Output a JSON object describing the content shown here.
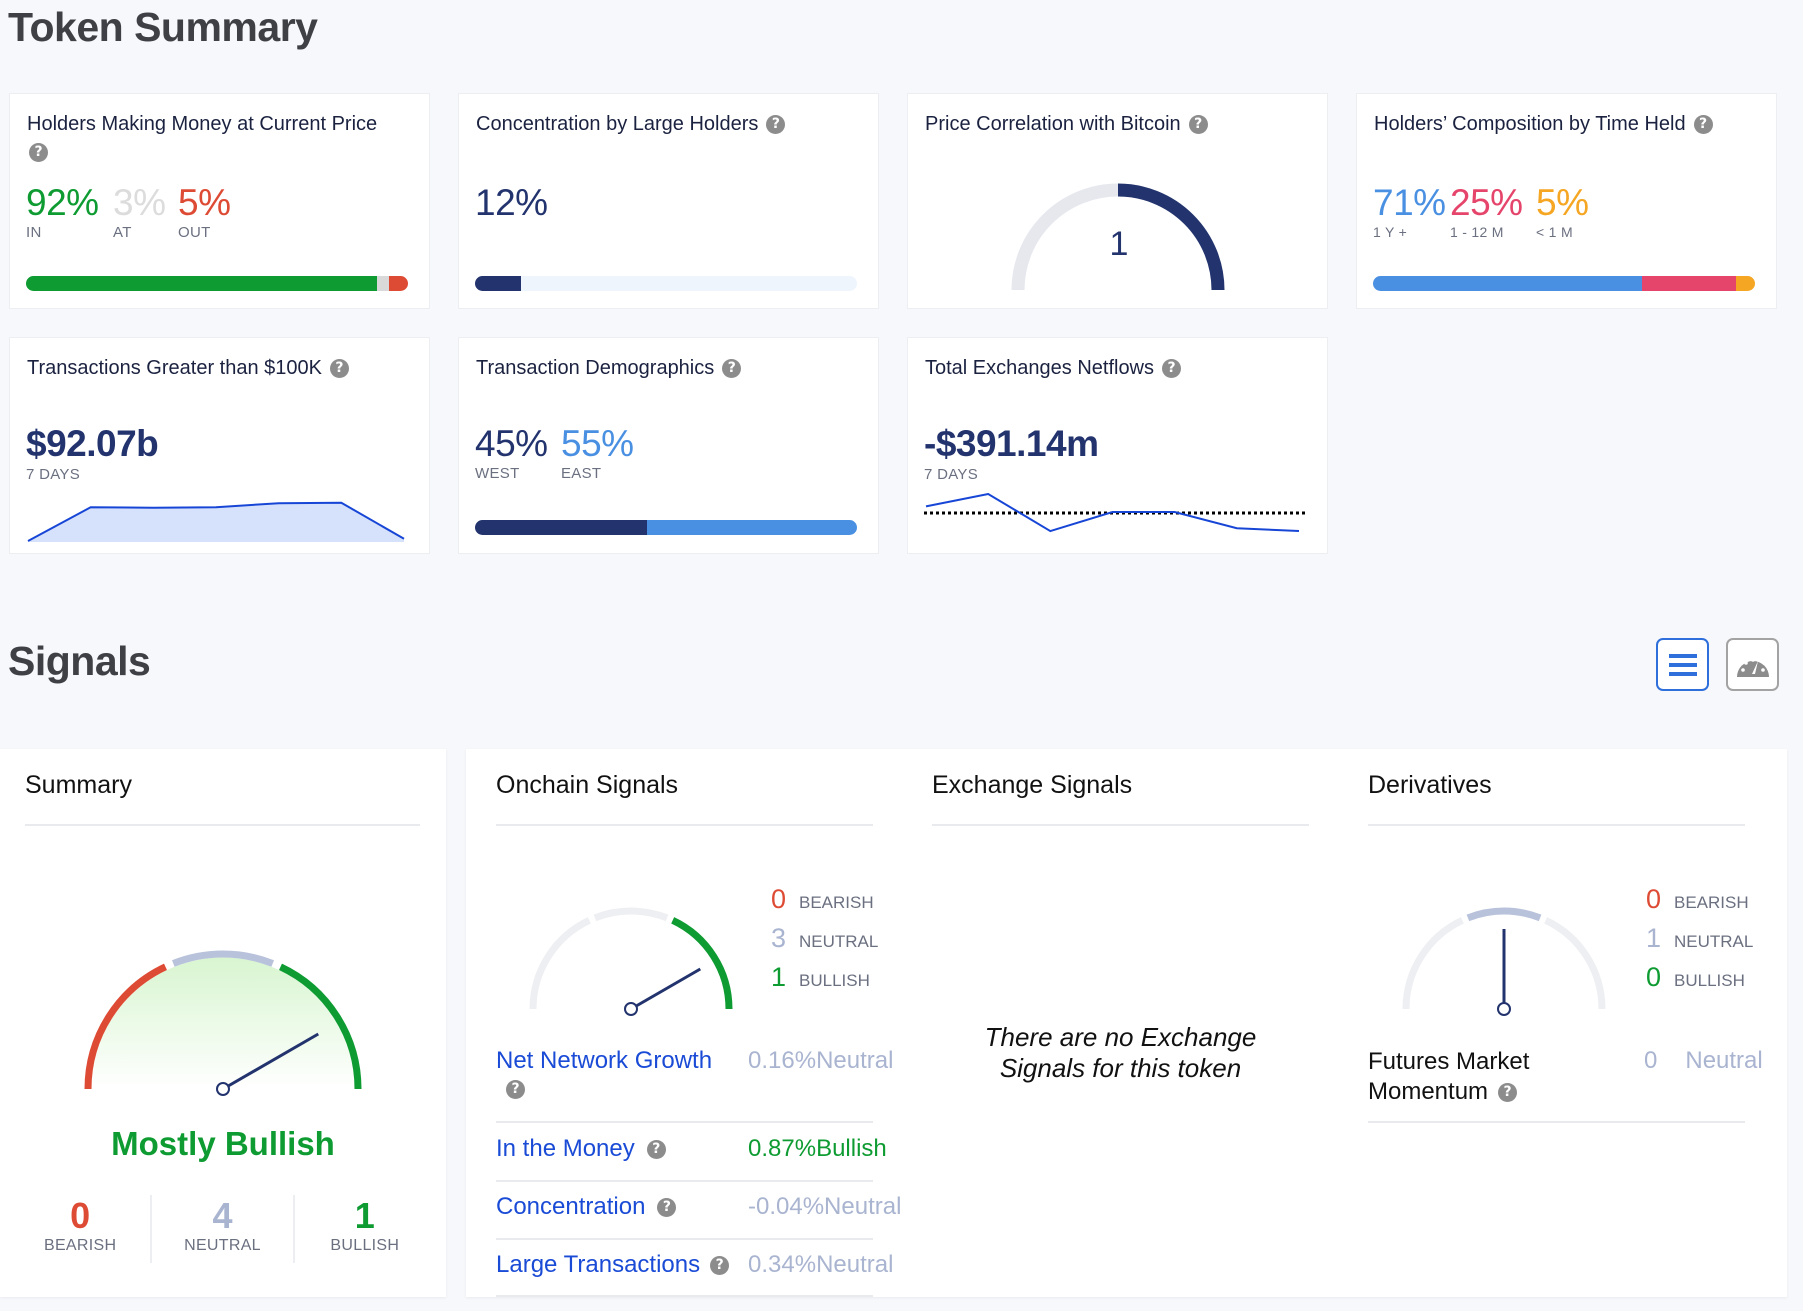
{
  "token_summary": {
    "title": "Token Summary",
    "cards": {
      "holders_money": {
        "title": "Holders Making Money at Current Price",
        "in": {
          "value": "92%",
          "label": "IN",
          "pct": 92,
          "color": "#0e9b32"
        },
        "at": {
          "value": "3%",
          "label": "AT",
          "pct": 3,
          "color": "#d9d9d9"
        },
        "out": {
          "value": "5%",
          "label": "OUT",
          "pct": 5,
          "color": "#de4b35"
        }
      },
      "concentration": {
        "title": "Concentration by Large Holders",
        "value": "12%",
        "pct": 12,
        "color": "#22336e",
        "track_color": "#eef5fd"
      },
      "correlation": {
        "title": "Price Correlation with Bitcoin",
        "value": "1",
        "correlation": 1
      },
      "time_held": {
        "title": "Holders’ Composition by Time Held",
        "segments": [
          {
            "value": "71%",
            "label": "1 Y +",
            "pct": 71,
            "color": "#4a90e2"
          },
          {
            "value": "25%",
            "label": "1 - 12 M",
            "pct": 25,
            "color": "#e6456b"
          },
          {
            "value": "5%",
            "label": "< 1 M",
            "pct": 5,
            "color": "#f5a623"
          }
        ]
      },
      "large_tx": {
        "title": "Transactions Greater than $100K",
        "value": "$92.07b",
        "period": "7 DAYS",
        "sparkline": [
          0,
          0.75,
          0.74,
          0.75,
          0.84,
          0.85,
          0.05
        ]
      },
      "demographics": {
        "title": "Transaction Demographics",
        "west": {
          "value": "45%",
          "label": "WEST",
          "pct": 45,
          "color": "#22336e"
        },
        "east": {
          "value": "55%",
          "label": "EAST",
          "pct": 55,
          "color": "#4a90e2"
        }
      },
      "netflows": {
        "title": "Total Exchanges Netflows",
        "value": "-$391.14m",
        "period": "7 DAYS",
        "sparkline": [
          0.35,
          1.0,
          -0.95,
          0.05,
          0.05,
          -0.8,
          -0.95
        ]
      }
    }
  },
  "signals": {
    "title": "Signals",
    "view_list_icon": "list-icon",
    "view_gauge_icon": "gauge-icon",
    "summary": {
      "heading": "Summary",
      "verdict": "Mostly Bullish",
      "verdict_color": "#0e9b32",
      "needle_angle_deg": 60,
      "counts": [
        {
          "num": "0",
          "label": "BEARISH",
          "color": "#de4b35"
        },
        {
          "num": "4",
          "label": "NEUTRAL",
          "color": "#a9b4d0"
        },
        {
          "num": "1",
          "label": "BULLISH",
          "color": "#0e9b32"
        }
      ]
    },
    "onchain": {
      "heading": "Onchain Signals",
      "needle_angle_deg": 60,
      "counts": [
        {
          "num": "0",
          "label": "BEARISH",
          "color": "#de4b35"
        },
        {
          "num": "3",
          "label": "NEUTRAL",
          "color": "#a9b4d0"
        },
        {
          "num": "1",
          "label": "BULLISH",
          "color": "#0e9b32"
        }
      ],
      "rows": [
        {
          "name": "Net Network Growth",
          "value": "0.16%",
          "status": "Neutral",
          "color": "#a9b4d0"
        },
        {
          "name": "In the Money",
          "value": "0.87%",
          "status": "Bullish",
          "color": "#0e9b32"
        },
        {
          "name": "Concentration",
          "value": "-0.04%",
          "status": "Neutral",
          "color": "#a9b4d0"
        },
        {
          "name": "Large Transactions",
          "value": "0.34%",
          "status": "Neutral",
          "color": "#a9b4d0"
        }
      ]
    },
    "exchange": {
      "heading": "Exchange Signals",
      "empty_line1": "There are no Exchange",
      "empty_line2": "Signals for this token"
    },
    "derivatives": {
      "heading": "Derivatives",
      "needle_angle_deg": 0,
      "counts": [
        {
          "num": "0",
          "label": "BEARISH",
          "color": "#de4b35"
        },
        {
          "num": "1",
          "label": "NEUTRAL",
          "color": "#a9b4d0"
        },
        {
          "num": "0",
          "label": "BULLISH",
          "color": "#0e9b32"
        }
      ],
      "rows": [
        {
          "name_line1": "Futures Market",
          "name_line2": "Momentum",
          "value": "0",
          "status": "Neutral",
          "color": "#a9b4d0"
        }
      ]
    }
  }
}
